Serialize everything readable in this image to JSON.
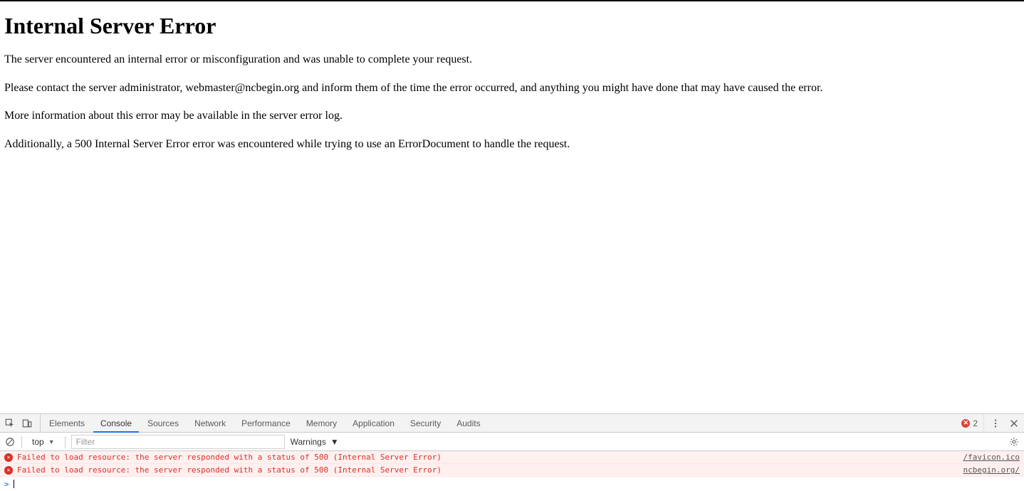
{
  "page": {
    "title": "Internal Server Error",
    "p1": "The server encountered an internal error or misconfiguration and was unable to complete your request.",
    "p2": "Please contact the server administrator, webmaster@ncbegin.org and inform them of the time the error occurred, and anything you might have done that may have caused the error.",
    "p3": "More information about this error may be available in the server error log.",
    "p4": "Additionally, a 500 Internal Server Error error was encountered while trying to use an ErrorDocument to handle the request."
  },
  "devtools": {
    "tabs": {
      "elements": "Elements",
      "console": "Console",
      "sources": "Sources",
      "network": "Network",
      "performance": "Performance",
      "memory": "Memory",
      "application": "Application",
      "security": "Security",
      "audits": "Audits"
    },
    "error_count": "2",
    "filter": {
      "context": "top",
      "placeholder": "Filter",
      "levels": "Warnings"
    },
    "console_rows": [
      {
        "msg": "Failed to load resource: the server responded with a status of 500 (Internal Server Error)",
        "src": "/favicon.ico"
      },
      {
        "msg": "Failed to load resource: the server responded with a status of 500 (Internal Server Error)",
        "src": "ncbegin.org/"
      }
    ]
  }
}
